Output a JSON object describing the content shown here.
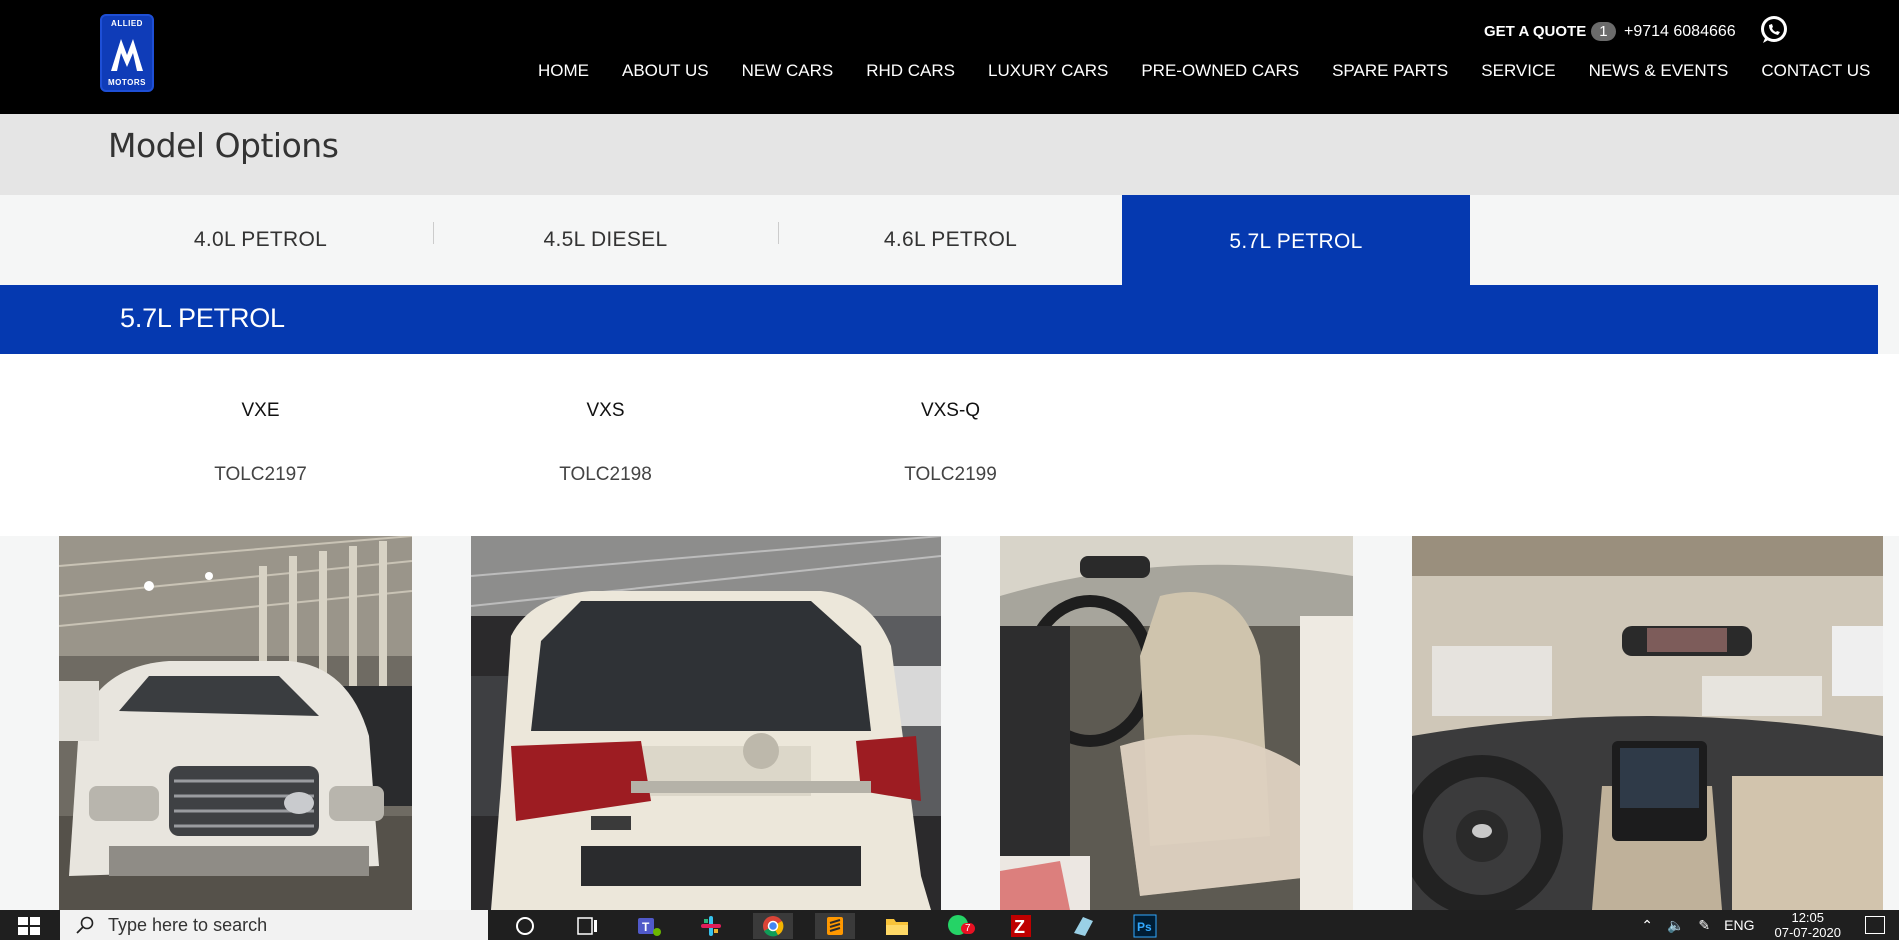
{
  "brand": {
    "logo_top": "ALLIED",
    "logo_bottom": "MOTORS",
    "primary_color": "#0539b0"
  },
  "header": {
    "quote_label": "GET A QUOTE",
    "quote_count": "1",
    "phone": "+9714 6084666",
    "nav": [
      "HOME",
      "ABOUT US",
      "NEW CARS",
      "RHD CARS",
      "LUXURY CARS",
      "PRE-OWNED CARS",
      "SPARE PARTS",
      "SERVICE",
      "NEWS & EVENTS",
      "CONTACT US"
    ]
  },
  "model_options": {
    "title": "Model Options",
    "tabs": [
      "4.0L PETROL",
      "4.5L DIESEL",
      "4.6L PETROL",
      "5.7L PETROL"
    ],
    "active_tab": "5.7L PETROL"
  },
  "variant": {
    "title": "5.7L PETROL",
    "models": [
      {
        "name": "VXE",
        "code": "TOLC2197"
      },
      {
        "name": "VXS",
        "code": "TOLC2198"
      },
      {
        "name": "VXS-Q",
        "code": "TOLC2199"
      }
    ]
  },
  "gallery": {
    "photos": [
      "front-exterior-photo",
      "rear-exterior-photo",
      "front-seat-interior-photo",
      "dashboard-interior-photo"
    ]
  },
  "taskbar": {
    "search_placeholder": "Type here to search",
    "language": "ENG",
    "time": "12:05",
    "date": "07-07-2020",
    "whatsapp_badge": "7",
    "apps": [
      "cortana-icon",
      "task-view-icon",
      "teams-icon",
      "slack-icon",
      "chrome-icon",
      "sublime-icon",
      "file-explorer-icon",
      "whatsapp-icon",
      "filezilla-icon",
      "notepad-icon",
      "photoshop-icon"
    ]
  }
}
